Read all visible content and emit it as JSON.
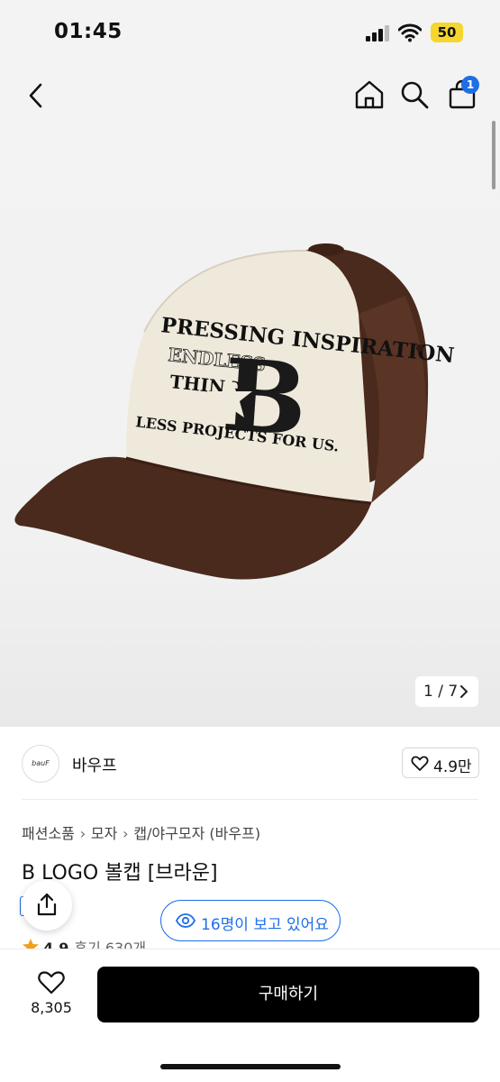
{
  "status_bar": {
    "time": "01:45",
    "battery": "50"
  },
  "nav": {
    "cart_badge": "1"
  },
  "gallery": {
    "counter": "1 / 7"
  },
  "product_image": {
    "embroidery_lines": [
      "PRESSING INSPIRATION",
      "ENDLESS",
      "THINGS",
      "B",
      "LESS PROJECTS FOR US."
    ]
  },
  "brand": {
    "logo_text": "bauF",
    "name": "바우프",
    "likes": "4.9만"
  },
  "breadcrumb": [
    "패션소품",
    "모자",
    "캡/야구모자 (바우프)"
  ],
  "product": {
    "title": "B LOGO 볼캡 [브라운]"
  },
  "viewers": {
    "text": "16명이 보고 있어요"
  },
  "rating": {
    "score": "4.9",
    "reviews": "후기 630개"
  },
  "bottom_bar": {
    "wish_count": "8,305",
    "buy_label": "구매하기"
  },
  "colors": {
    "accent": "#1e6ee8",
    "buy_button": "#000000",
    "cap_brown": "#4a2a1c",
    "cap_cream": "#efe9dc",
    "rating_star": "#f0a020"
  }
}
